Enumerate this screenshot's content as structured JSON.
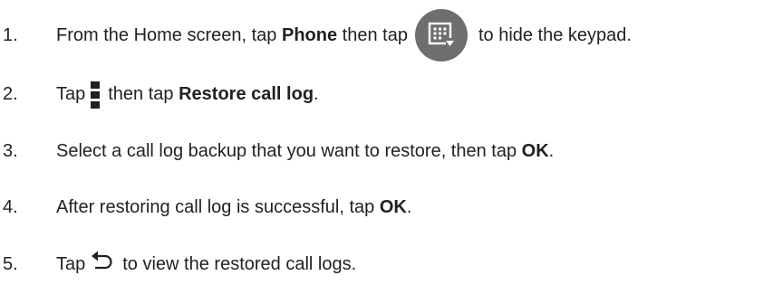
{
  "steps": [
    {
      "number": "1.",
      "part1": "From the Home screen, tap ",
      "bold1": "Phone",
      "part2": " then tap",
      "icon": "hide-keypad-icon",
      "part3": "to hide the keypad."
    },
    {
      "number": "2.",
      "part1": "Tap",
      "icon": "menu-icon",
      "part2": "then tap ",
      "bold1": "Restore call log",
      "part3": "."
    },
    {
      "number": "3.",
      "part1": "Select a call log backup that you want to restore, then tap ",
      "bold1": "OK",
      "part2": "."
    },
    {
      "number": "4.",
      "part1": "After restoring call log is successful, tap ",
      "bold1": "OK",
      "part2": "."
    },
    {
      "number": "5.",
      "part1": "Tap",
      "icon": "back-icon",
      "part2": "to view the restored call logs."
    }
  ],
  "colors": {
    "text": "#231f20",
    "icon_button": "#6d6e70",
    "icon_glyph": "#ffffff"
  }
}
